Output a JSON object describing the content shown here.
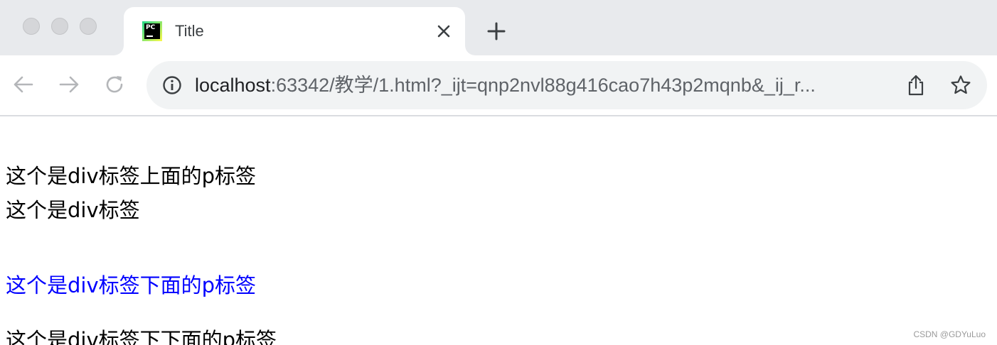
{
  "tab": {
    "title": "Title",
    "favicon_label": "PC"
  },
  "address_bar": {
    "url_host": "localhost",
    "url_rest": ":63342/教学/1.html?_ijt=qnp2nvl88g416cao7h43p2mqnb&_ij_r..."
  },
  "content": {
    "lines": [
      "这个是div标签上面的p标签",
      "这个是div标签",
      "这个是div标签下面的p标签",
      "这个是div标签下下面的p标签"
    ],
    "highlight_color": "#0000ff"
  },
  "watermark": "CSDN @GDYuLuo"
}
